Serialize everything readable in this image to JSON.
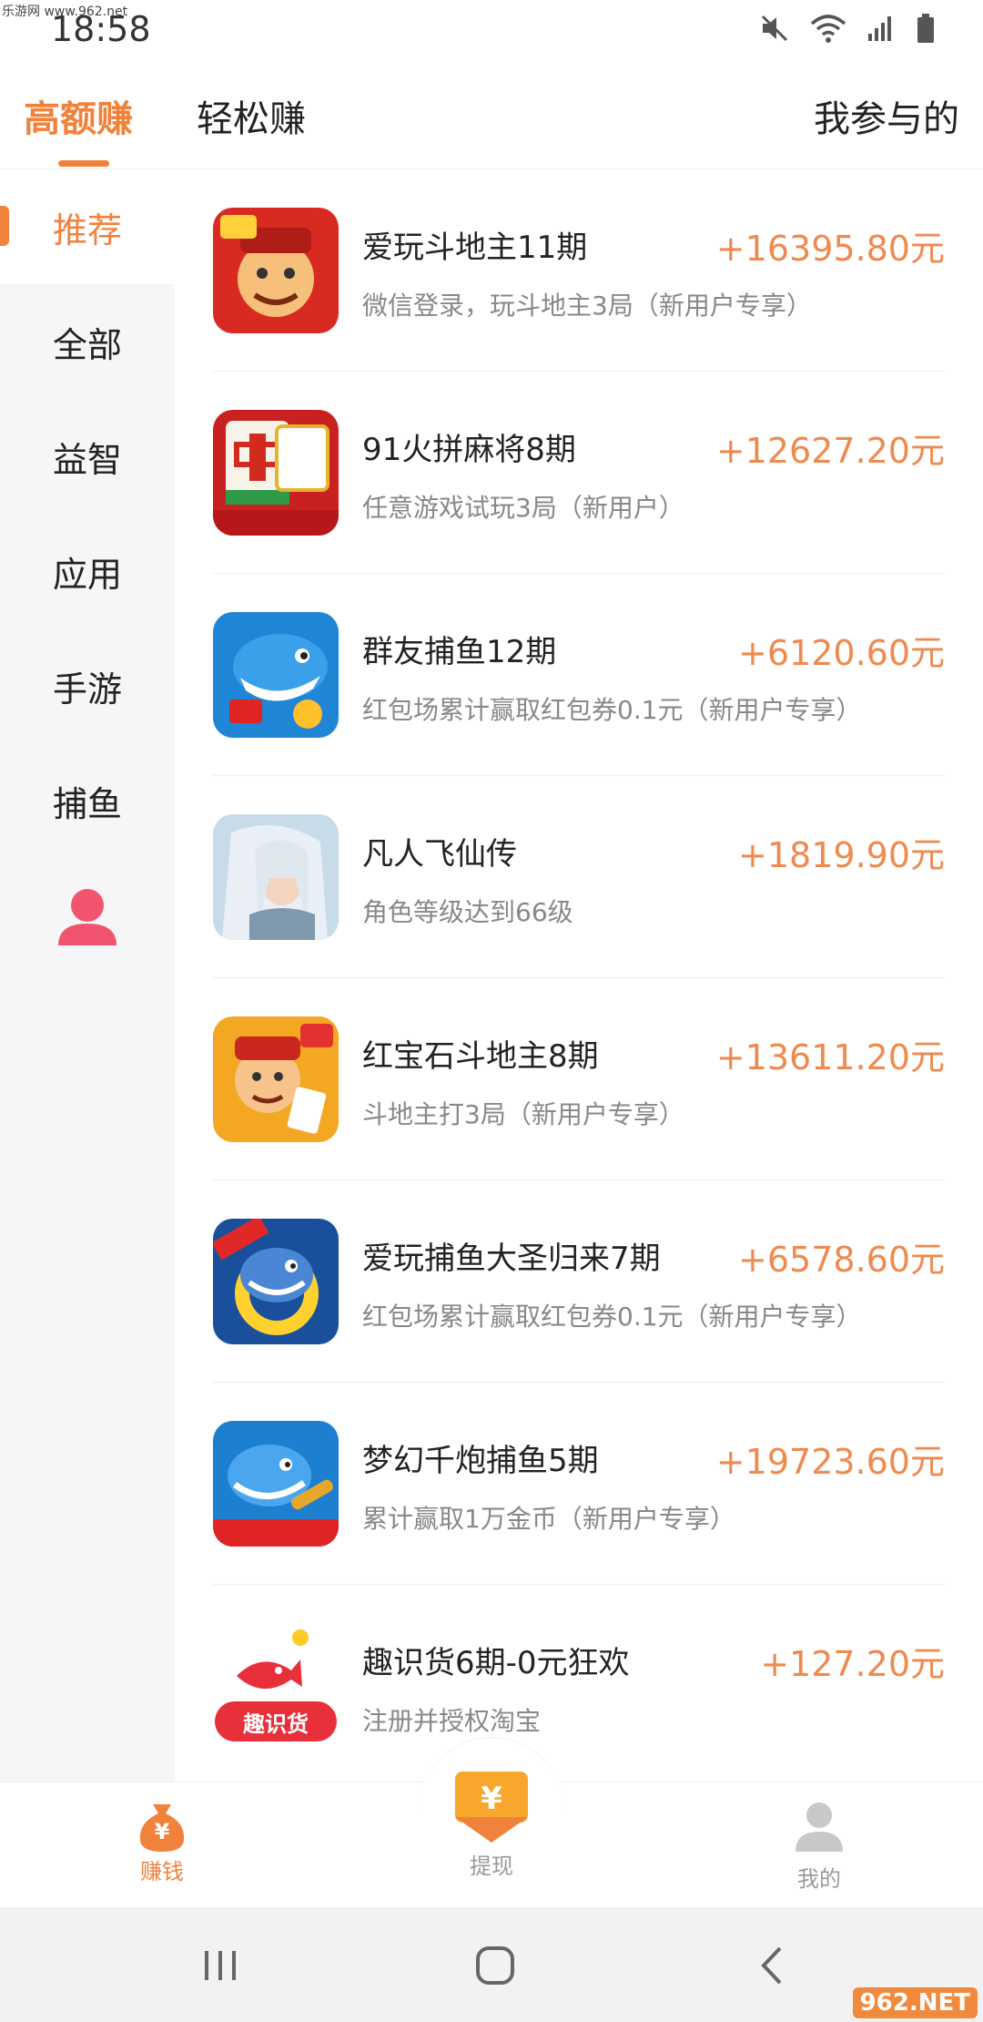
{
  "status_bar": {
    "watermark": "乐游网 www.962.net",
    "time": "18:58",
    "icons": [
      "mute-icon",
      "wifi-icon",
      "signal-icon",
      "battery-icon"
    ]
  },
  "header": {
    "tabs": [
      {
        "label": "高额赚",
        "active": true
      },
      {
        "label": "轻松赚",
        "active": false
      }
    ],
    "right_label": "我参与的"
  },
  "sidebar": {
    "items": [
      {
        "label": "推荐",
        "active": true
      },
      {
        "label": "全部",
        "active": false
      },
      {
        "label": "益智",
        "active": false
      },
      {
        "label": "应用",
        "active": false
      },
      {
        "label": "手游",
        "active": false
      },
      {
        "label": "捕鱼",
        "active": false
      }
    ],
    "user_icon": "user-icon"
  },
  "list": {
    "items": [
      {
        "title": "爱玩斗地主11期",
        "subtitle": "微信登录，玩斗地主3局（新用户专享）",
        "amount": "+16395.80元",
        "icon": "doudizhu-icon"
      },
      {
        "title": "91火拼麻将8期",
        "subtitle": "任意游戏试玩3局（新用户）",
        "amount": "+12627.20元",
        "icon": "mahjong-icon"
      },
      {
        "title": "群友捕鱼12期",
        "subtitle": "红包场累计赢取红包券0.1元（新用户专享）",
        "amount": "+6120.60元",
        "icon": "shark-icon"
      },
      {
        "title": "凡人飞仙传",
        "subtitle": "角色等级达到66级",
        "amount": "+1819.90元",
        "icon": "immortal-icon"
      },
      {
        "title": "红宝石斗地主8期",
        "subtitle": "斗地主打3局（新用户专享）",
        "amount": "+13611.20元",
        "icon": "ruby-doudizhu-icon"
      },
      {
        "title": "爱玩捕鱼大圣归来7期",
        "subtitle": "红包场累计赢取红包券0.1元（新用户专享）",
        "amount": "+6578.60元",
        "icon": "fishing-3d-icon"
      },
      {
        "title": "梦幻千炮捕鱼5期",
        "subtitle": "累计赢取1万金币（新用户专享）",
        "amount": "+19723.60元",
        "icon": "cannon-fish-icon"
      },
      {
        "title": "趣识货6期-0元狂欢",
        "subtitle": "注册并授权淘宝",
        "amount": "+127.20元",
        "icon": "qushihuo-icon",
        "icon_text": "趣识货"
      }
    ]
  },
  "bottom_nav": {
    "items": [
      {
        "label": "赚钱",
        "icon": "money-bag-icon",
        "active": true
      },
      {
        "label": "提现",
        "icon": "withdraw-icon",
        "active": false
      },
      {
        "label": "我的",
        "icon": "profile-icon",
        "active": false
      }
    ],
    "money_glyph": "¥"
  },
  "system_nav": {
    "buttons": [
      "recents-icon",
      "home-icon",
      "back-icon"
    ],
    "watermark": "962.NET"
  },
  "colors": {
    "accent": "#f0823c",
    "amount": "#ef8a4f",
    "sidebar_bg": "#f6f6f8"
  }
}
